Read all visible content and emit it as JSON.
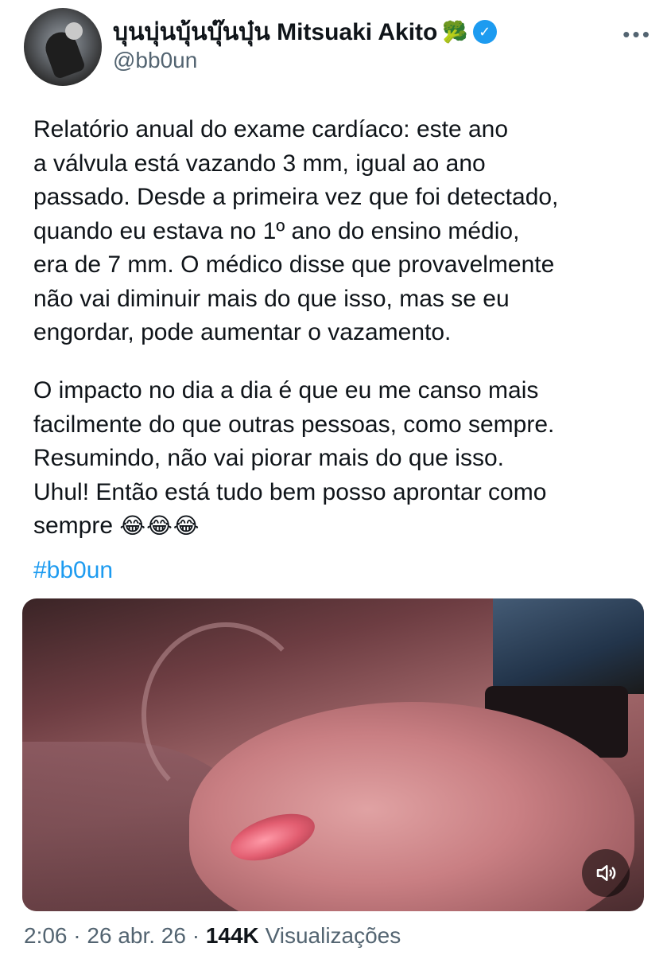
{
  "author": {
    "display_name": "บุนบุ่นบุ้นบุ๊นบุ๋น Mitsuaki Akito",
    "name_emoji": "🥦",
    "handle": "@bb0un",
    "verified": true,
    "avatar_icon": "user-avatar"
  },
  "tweet": {
    "paragraph_1": "Relatório anual do exame cardíaco: este ano\na válvula está vazando 3 mm, igual ao ano\npassado. Desde a primeira vez que foi detectado,\nquando eu estava no 1º ano do ensino médio,\nera de 7 mm. O médico disse que provavelmente\nnão vai diminuir mais do que isso, mas se eu\nengordar, pode aumentar o vazamento.",
    "paragraph_2": "O impacto no dia a dia é que eu me canso mais\nfacilmente do que outras pessoas, como sempre.\nResumindo, não vai piorar mais do que isso.\nUhul! Então está tudo bem posso aprontar como\nsempre ",
    "emojis": "😂😂😂",
    "hashtag": "#bb0un"
  },
  "media": {
    "type": "video",
    "sound_icon": "speaker-muted-icon"
  },
  "meta": {
    "time": "2:06",
    "separator": "·",
    "date": "26 abr. 26",
    "views_count": "144K",
    "views_label": "Visualizações"
  },
  "colors": {
    "accent": "#1d9bf0",
    "text": "#0f1419",
    "secondary": "#536471"
  }
}
